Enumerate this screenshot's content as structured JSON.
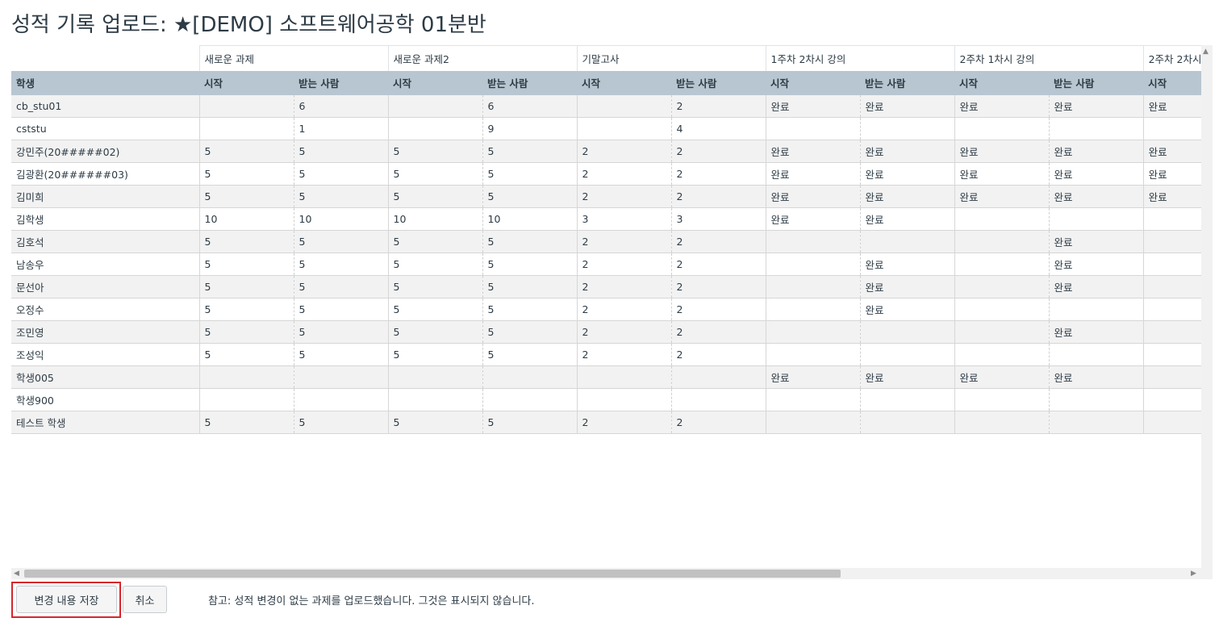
{
  "title": "성적 기록 업로드: ★[DEMO] 소프트웨어공학 01분반",
  "assignments": [
    "새로운 과제",
    "새로운 과제2",
    "기말고사",
    "1주차 2차시 강의",
    "2주차 1차시 강의",
    "2주차 2차시"
  ],
  "headers": [
    "학생",
    "시작",
    "받는 사람",
    "시작",
    "받는 사람",
    "시작",
    "받는 사람",
    "시작",
    "받는 사람",
    "시작",
    "받는 사람",
    "시작"
  ],
  "rows": [
    [
      "cb_stu01",
      "",
      "6",
      "",
      "6",
      "",
      "2",
      "완료",
      "완료",
      "완료",
      "완료",
      "완료"
    ],
    [
      "cststu",
      "",
      "1",
      "",
      "9",
      "",
      "4",
      "",
      "",
      "",
      "",
      ""
    ],
    [
      "강민주(20#####02)",
      "5",
      "5",
      "5",
      "5",
      "2",
      "2",
      "완료",
      "완료",
      "완료",
      "완료",
      "완료"
    ],
    [
      "김광환(20######03)",
      "5",
      "5",
      "5",
      "5",
      "2",
      "2",
      "완료",
      "완료",
      "완료",
      "완료",
      "완료"
    ],
    [
      "김미희",
      "5",
      "5",
      "5",
      "5",
      "2",
      "2",
      "완료",
      "완료",
      "완료",
      "완료",
      "완료"
    ],
    [
      "김학생",
      "10",
      "10",
      "10",
      "10",
      "3",
      "3",
      "완료",
      "완료",
      "",
      "",
      ""
    ],
    [
      "김호석",
      "5",
      "5",
      "5",
      "5",
      "2",
      "2",
      "",
      "",
      "",
      "완료",
      ""
    ],
    [
      "남송우",
      "5",
      "5",
      "5",
      "5",
      "2",
      "2",
      "",
      "완료",
      "",
      "완료",
      ""
    ],
    [
      "문선아",
      "5",
      "5",
      "5",
      "5",
      "2",
      "2",
      "",
      "완료",
      "",
      "완료",
      ""
    ],
    [
      "오정수",
      "5",
      "5",
      "5",
      "5",
      "2",
      "2",
      "",
      "완료",
      "",
      "",
      ""
    ],
    [
      "조민영",
      "5",
      "5",
      "5",
      "5",
      "2",
      "2",
      "",
      "",
      "",
      "완료",
      ""
    ],
    [
      "조성익",
      "5",
      "5",
      "5",
      "5",
      "2",
      "2",
      "",
      "",
      "",
      "",
      ""
    ],
    [
      "학생005",
      "",
      "",
      "",
      "",
      "",
      "",
      "완료",
      "완료",
      "완료",
      "완료",
      ""
    ],
    [
      "학생900",
      "",
      "",
      "",
      "",
      "",
      "",
      "",
      "",
      "",
      "",
      ""
    ],
    [
      "테스트 학생",
      "5",
      "5",
      "5",
      "5",
      "2",
      "2",
      "",
      "",
      "",
      "",
      ""
    ]
  ],
  "buttons": {
    "save": "변경 내용 저장",
    "cancel": "취소"
  },
  "note": "참고: 성적 변경이 없는 과제를 업로드했습니다. 그것은 표시되지 않습니다.",
  "colors": {
    "header_bg": "#b8c6d1",
    "row_alt": "#f2f2f2",
    "highlight": "#d6262b"
  },
  "icons": {
    "scroll_up": "▲",
    "scroll_left": "◀",
    "scroll_right": "▶"
  }
}
